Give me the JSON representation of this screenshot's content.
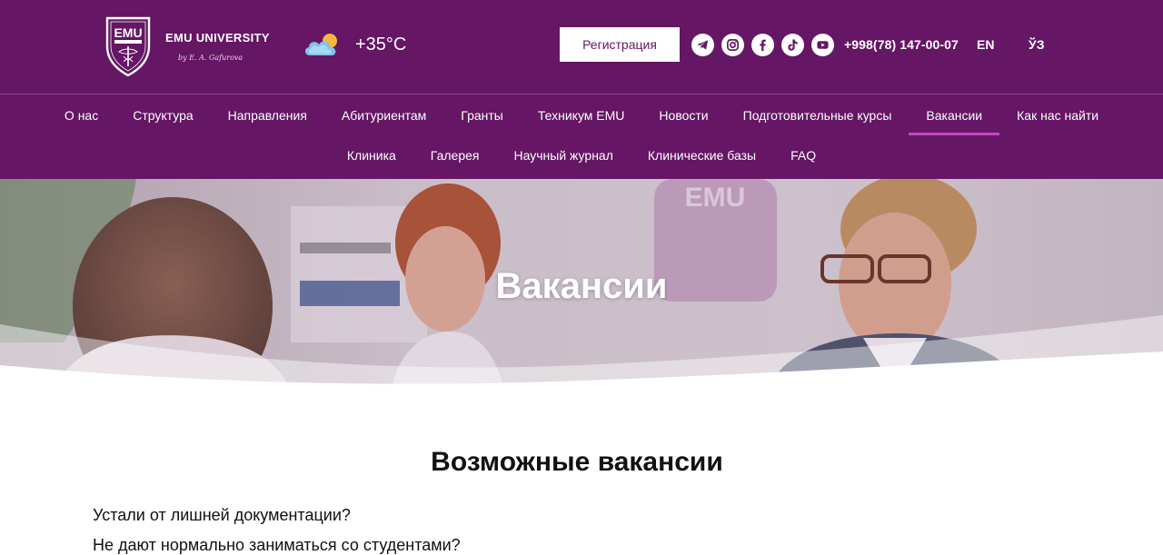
{
  "header": {
    "brand": "EMU UNIVERSITY",
    "brand_signature": "by E. A. Gafurova",
    "shield_text": "EMU",
    "weather_temp": "+35°C",
    "register_label": "Регистрация",
    "phone": "+998(78) 147-00-07",
    "lang_en": "EN",
    "lang_uz": "ЎЗ",
    "socials": [
      "telegram-icon",
      "instagram-icon",
      "facebook-icon",
      "tiktok-icon",
      "youtube-icon"
    ]
  },
  "nav": {
    "row1": [
      "О нас",
      "Структура",
      "Направления",
      "Абитуриентам",
      "Гранты",
      "Техникум EMU",
      "Новости",
      "Подготовительные курсы",
      "Вакансии",
      "Как нас найти"
    ],
    "row2": [
      "Клиника",
      "Галерея",
      "Научный журнал",
      "Клинические базы",
      "FAQ"
    ],
    "active": "Вакансии"
  },
  "hero": {
    "title": "Вакансии",
    "bg_logo_text": "EMU"
  },
  "content": {
    "section_title": "Возможные вакансии",
    "paragraphs": [
      "Устали от лишней документации?",
      "Не дают нормально заниматься со студентами?"
    ]
  },
  "colors": {
    "brand": "#651664",
    "accent": "#c149c4",
    "white": "#ffffff"
  }
}
